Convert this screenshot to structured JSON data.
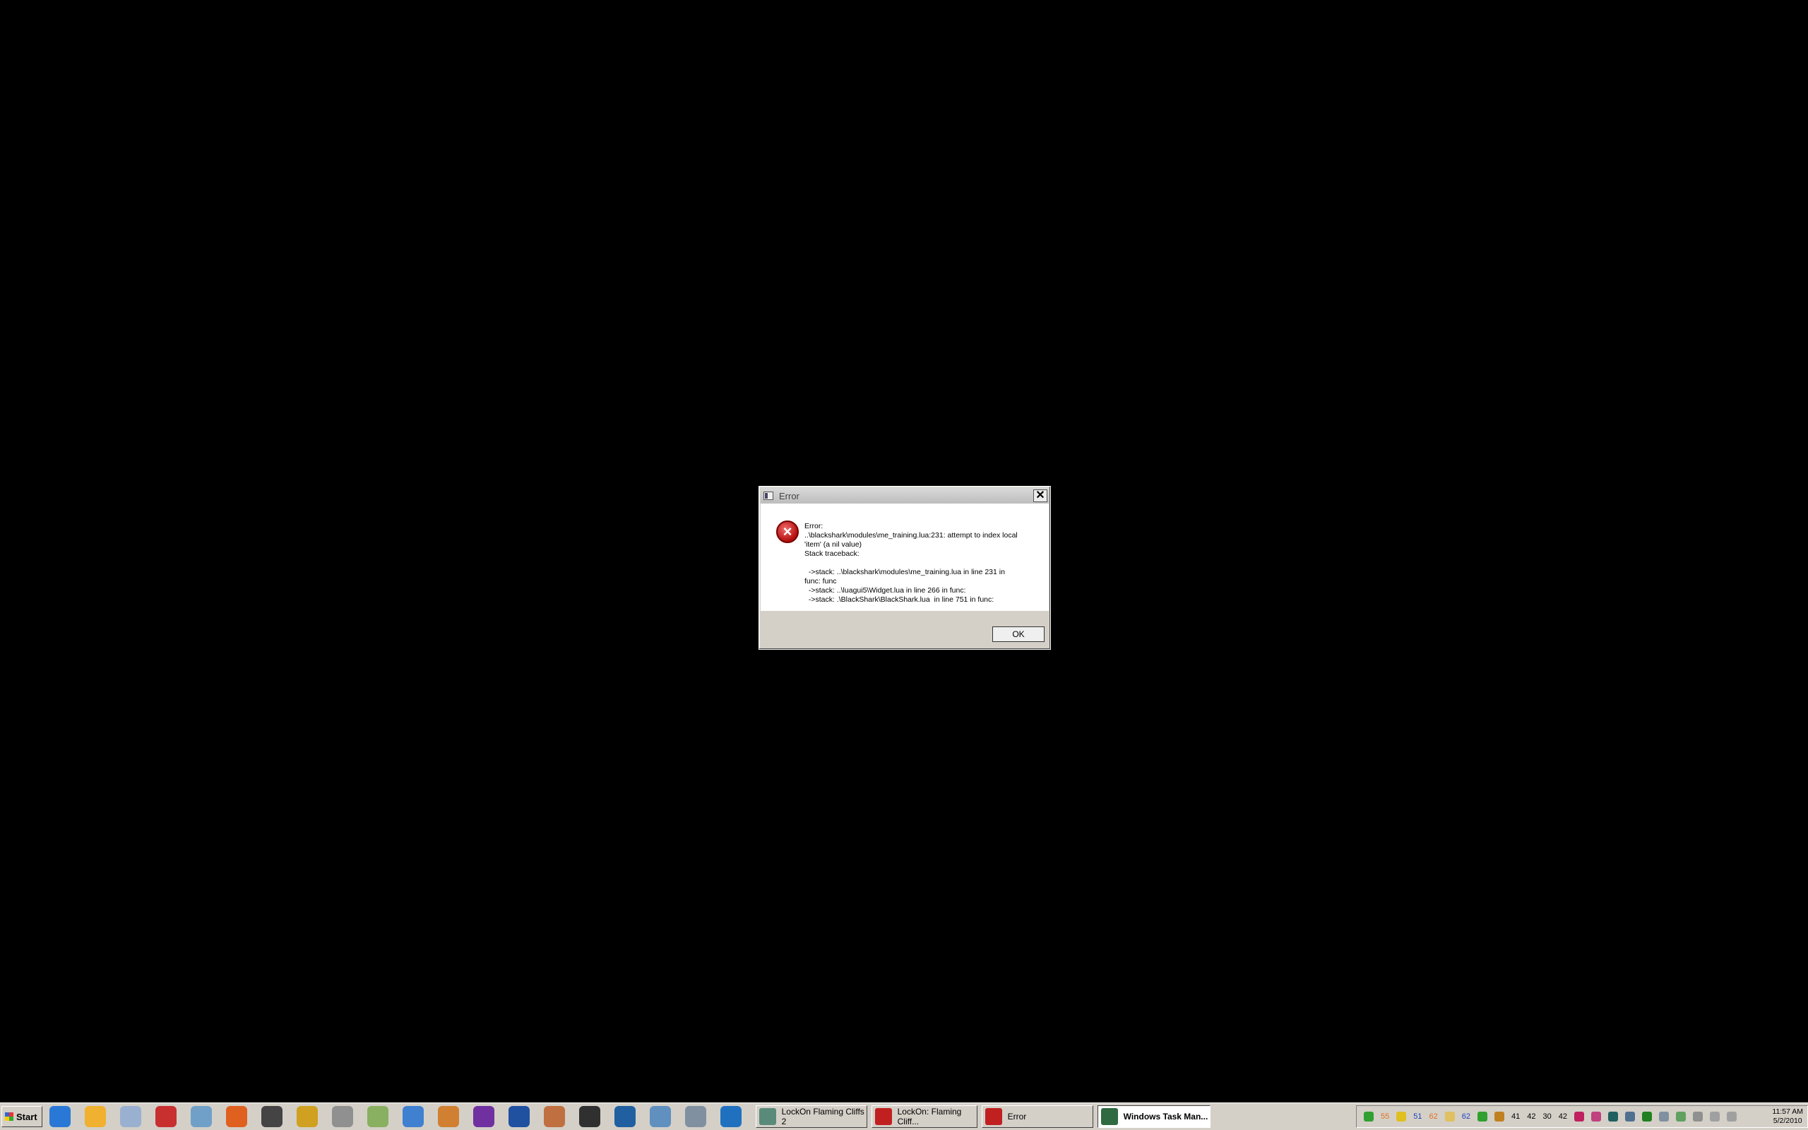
{
  "dialog": {
    "title": "Error",
    "close_label": "✕",
    "message": "Error:\n..\\blackshark\\modules\\me_training.lua:231: attempt to index local\n'item' (a nil value)\nStack traceback:\n\n  ->stack: ..\\blackshark\\modules\\me_training.lua in line 231 in\nfunc: func\n  ->stack: ..\\luagui5\\Widget.lua in line 266 in func:\n  ->stack: .\\BlackShark\\BlackShark.lua  in line 751 in func:",
    "ok_label": "OK",
    "error_icon": "error-x-icon"
  },
  "taskbar": {
    "start_label": "Start",
    "quick_launch": [
      {
        "name": "internet-explorer-icon",
        "color": "#2a78d6"
      },
      {
        "name": "outlook-icon",
        "color": "#f0b030"
      },
      {
        "name": "calculator-icon",
        "color": "#9ab0d0"
      },
      {
        "name": "antivirus-icon",
        "color": "#c83030"
      },
      {
        "name": "feather-icon",
        "color": "#70a0c8"
      },
      {
        "name": "firefox-icon",
        "color": "#e06020"
      },
      {
        "name": "media-icon",
        "color": "#444444"
      },
      {
        "name": "tools-icon",
        "color": "#d0a020"
      },
      {
        "name": "cursor-icon",
        "color": "#909090"
      },
      {
        "name": "paint-icon",
        "color": "#88b060"
      },
      {
        "name": "itunes-icon",
        "color": "#4080d0"
      },
      {
        "name": "monkey-icon",
        "color": "#d08030"
      },
      {
        "name": "yahoo-messenger-icon",
        "color": "#7030a0"
      },
      {
        "name": "word-icon",
        "color": "#2050a0"
      },
      {
        "name": "hand-icon",
        "color": "#c07040"
      },
      {
        "name": "eye-icon",
        "color": "#303030"
      },
      {
        "name": "network-icon",
        "color": "#2060a0"
      },
      {
        "name": "window-icon",
        "color": "#6090c0"
      },
      {
        "name": "globe-icon",
        "color": "#8090a0"
      },
      {
        "name": "fraps-icon",
        "color": "#2070c0"
      }
    ],
    "tasks": [
      {
        "label": "LockOn Flaming Cliffs 2",
        "color": "#5a8a7a",
        "active": false,
        "width": 158
      },
      {
        "label": "LockOn: Flaming Cliff...",
        "color": "#c02020",
        "active": false,
        "width": 150
      },
      {
        "label": "Error",
        "color": "#c02020",
        "active": false,
        "width": 158
      },
      {
        "label": "Windows Task Man...",
        "color": "#2f6a40",
        "active": true,
        "width": 160
      }
    ],
    "tray": [
      {
        "name": "tray-globe-icon",
        "color": "#30a030"
      },
      {
        "name": "tray-temp-1",
        "text": "55",
        "color": "#e07020"
      },
      {
        "name": "tray-star-icon",
        "color": "#e0c020"
      },
      {
        "name": "tray-temp-2",
        "text": "51",
        "color": "#2040c0"
      },
      {
        "name": "tray-temp-3",
        "text": "62",
        "color": "#e07020"
      },
      {
        "name": "tray-folder-icon",
        "color": "#e0c060"
      },
      {
        "name": "tray-temp-4",
        "text": "62",
        "color": "#2040c0"
      },
      {
        "name": "tray-sync-icon",
        "color": "#30a030"
      },
      {
        "name": "tray-gear-icon",
        "color": "#c08020"
      },
      {
        "name": "tray-41-icon",
        "text": "41",
        "color": "#000000"
      },
      {
        "name": "tray-42-icon",
        "text": "42",
        "color": "#000000"
      },
      {
        "name": "tray-30-icon",
        "text": "30",
        "color": "#000000"
      },
      {
        "name": "tray-42b-icon",
        "text": "42",
        "color": "#000000"
      },
      {
        "name": "tray-app-icon",
        "color": "#c02060"
      },
      {
        "name": "tray-doc-icon",
        "color": "#c04080"
      },
      {
        "name": "tray-monitor-icon",
        "color": "#206060"
      },
      {
        "name": "tray-network-icon",
        "color": "#507090"
      },
      {
        "name": "tray-green-icon",
        "color": "#208020"
      },
      {
        "name": "tray-computer-icon",
        "color": "#8090a0"
      },
      {
        "name": "tray-security-icon",
        "color": "#60a060"
      },
      {
        "name": "tray-flag-icon",
        "color": "#909090"
      },
      {
        "name": "tray-signal-icon",
        "color": "#a0a0a0"
      },
      {
        "name": "tray-volume-icon",
        "color": "#a0a0a0"
      }
    ],
    "clock_time": "11:57 AM",
    "clock_date": "5/2/2010"
  }
}
